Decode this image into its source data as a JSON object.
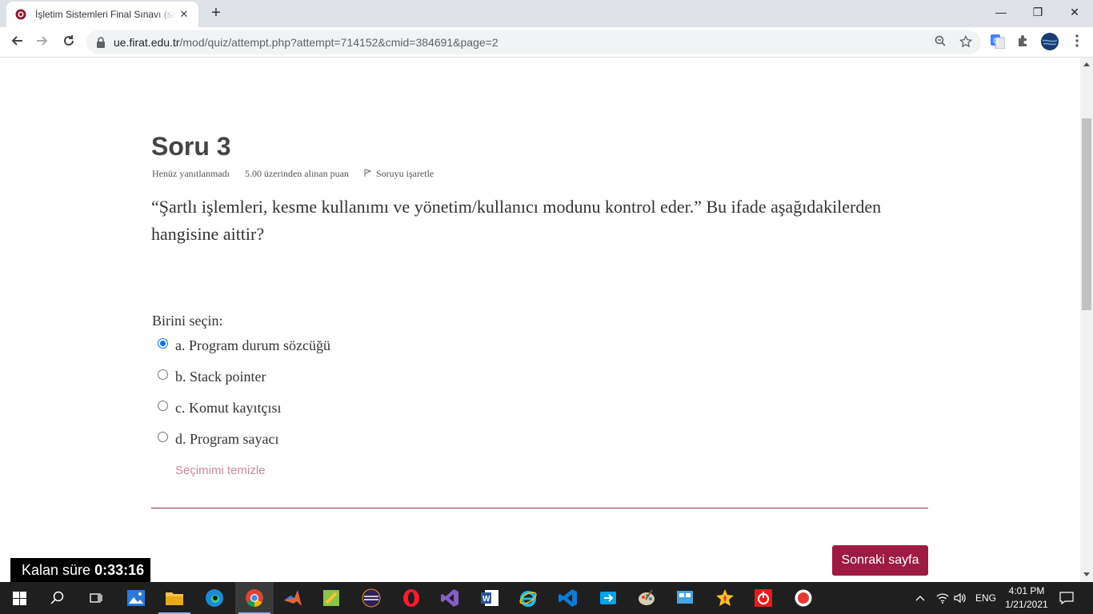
{
  "browser": {
    "tab_title": "İşletim Sistemleri Final Sınavı (say",
    "tab_close": "✕",
    "new_tab": "+",
    "minimize": "—",
    "restore": "❐",
    "close": "✕",
    "url_host": "ue.firat.edu.tr",
    "url_path": "/mod/quiz/attempt.php?attempt=714152&cmid=384691&page=2"
  },
  "question": {
    "title": "Soru 3",
    "status": "Henüz yanıtlanmadı",
    "points": "5.00 üzerinden alınan puan",
    "flag_label": "Soruyu işaretle",
    "text": "“Şartlı işlemleri, kesme kullanımı ve yönetim/kullanıcı modunu kontrol eder.” Bu ifade aşağıdakilerden hangisine aittir?",
    "choose_label": "Birini seçin:",
    "options": [
      {
        "label": "a. Program durum sözcüğü",
        "selected": true
      },
      {
        "label": "b. Stack pointer",
        "selected": false
      },
      {
        "label": "c. Komut kayıtçısı",
        "selected": false
      },
      {
        "label": "d. Program sayacı",
        "selected": false
      }
    ],
    "clear_label": "Seçimimi temizle"
  },
  "navigation": {
    "next_label": "Sonraki sayfa"
  },
  "timer": {
    "label": "Kalan süre",
    "value": "0:33:16"
  },
  "taskbar": {
    "language": "ENG",
    "time": "4:01 PM",
    "date": "1/21/2021"
  },
  "colors": {
    "accent": "#9c1a44",
    "clear_link": "#c9899b",
    "radio_selected": "#0075ff"
  }
}
